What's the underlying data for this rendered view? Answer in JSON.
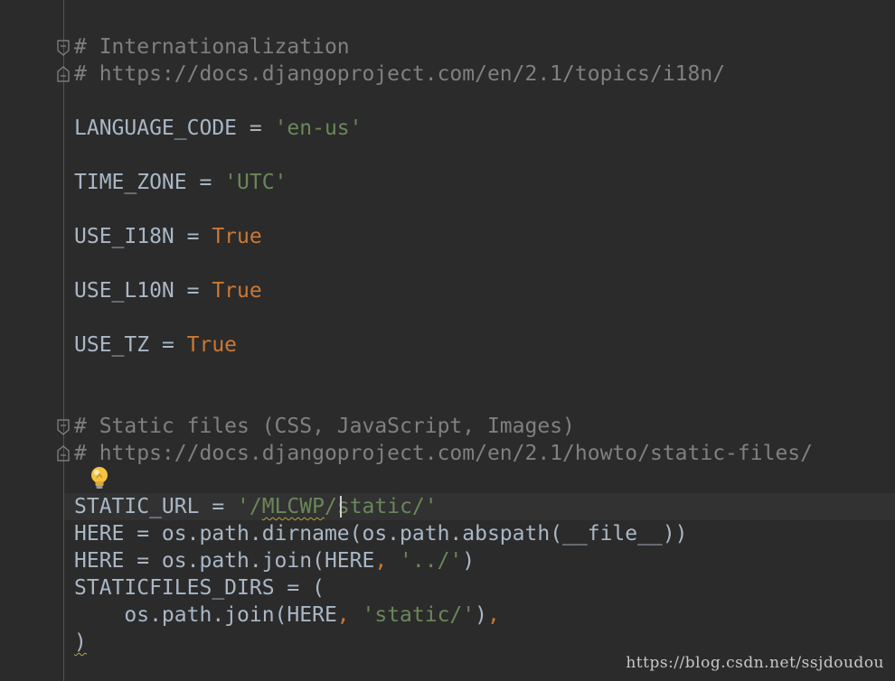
{
  "code": {
    "comment_i18n": "# Internationalization",
    "comment_i18n_url": "# https://docs.djangoproject.com/en/2.1/topics/i18n/",
    "language_code": {
      "name": "LANGUAGE_CODE",
      "op": " = ",
      "value": "'en-us'"
    },
    "time_zone": {
      "name": "TIME_ZONE",
      "op": " = ",
      "value": "'UTC'"
    },
    "use_i18n": {
      "name": "USE_I18N",
      "op": " = ",
      "value": "True"
    },
    "use_l10n": {
      "name": "USE_L10N",
      "op": " = ",
      "value": "True"
    },
    "use_tz": {
      "name": "USE_TZ",
      "op": " = ",
      "value": "True"
    },
    "comment_static": "# Static files (CSS, JavaScript, Images)",
    "comment_static_url": "# https://docs.djangoproject.com/en/2.1/howto/static-files/",
    "static_url": {
      "name": "STATIC_URL",
      "op": " = ",
      "str_open": "'/",
      "str_squiggle": "MLCWP",
      "str_mid": "/",
      "str_after_caret": "static/'"
    },
    "here_1": "HERE = os.path.dirname(os.path.abspath(__file__))",
    "here_2": {
      "pre": "HERE = os.path.join(HERE",
      "comma": ", ",
      "str": "'../'",
      "post": ")"
    },
    "staticfiles_dirs": "STATICFILES_DIRS = (",
    "join_line": {
      "pre": "    os.path.join(HERE",
      "comma": ", ",
      "str": "'static/'",
      "post": ")",
      "trail": ","
    },
    "close_paren": ")"
  },
  "watermark": "https://blog.csdn.net/ssjdoudou",
  "icons": {
    "fold": "fold-marker-icon",
    "bulb": "lightbulb-intention-icon"
  },
  "colors": {
    "background": "#2b2b2b",
    "text": "#a9b7c6",
    "comment": "#808080",
    "string": "#6a8759",
    "keyword": "#cc7832",
    "bulb": "#f5c242"
  }
}
